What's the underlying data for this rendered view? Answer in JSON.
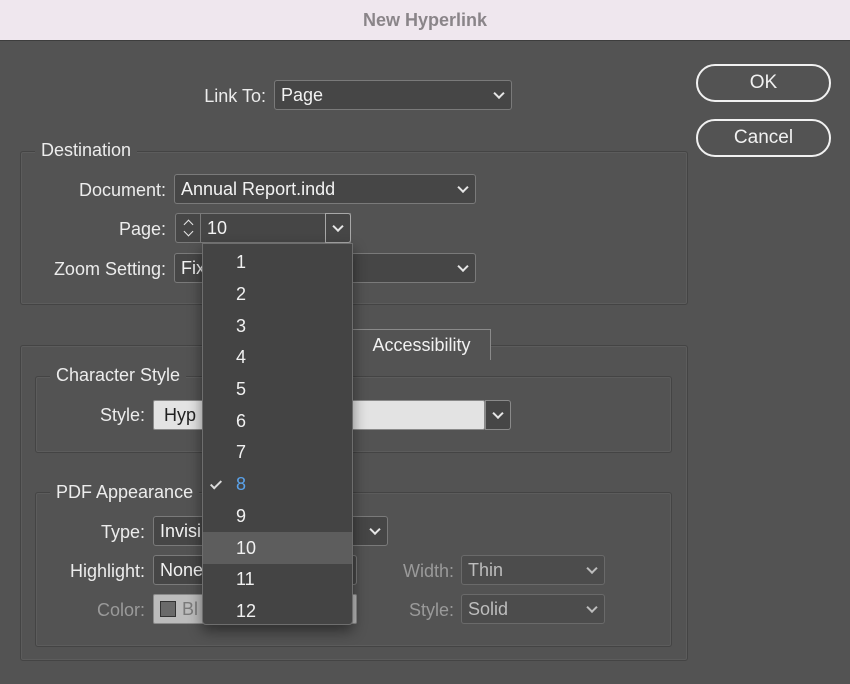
{
  "window": {
    "title": "New Hyperlink"
  },
  "link_to": {
    "label": "Link To:",
    "value": "Page"
  },
  "buttons": {
    "ok": "OK",
    "cancel": "Cancel"
  },
  "destination": {
    "title": "Destination",
    "document_label": "Document:",
    "document_value": "Annual Report.indd",
    "page_label": "Page:",
    "page_value": "10",
    "zoom_label": "Zoom Setting:",
    "zoom_value": "Fix"
  },
  "tabs": {
    "accessibility": "Accessibility"
  },
  "character_style": {
    "title": "Character Style",
    "style_label": "Style:",
    "style_value": "Hyp"
  },
  "pdf_appearance": {
    "title": "PDF Appearance",
    "type_label": "Type:",
    "type_value": "Invisi",
    "highlight_label": "Highlight:",
    "highlight_value": "None",
    "color_label": "Color:",
    "color_value": "Bl",
    "width_label": "Width:",
    "width_value": "Thin",
    "style_label": "Style:",
    "style_value": "Solid"
  },
  "page_menu": {
    "items": [
      "1",
      "2",
      "3",
      "4",
      "5",
      "6",
      "7",
      "8",
      "9",
      "10",
      "11",
      "12"
    ],
    "checked": "8",
    "highlighted": "10"
  },
  "colors": {
    "background": "#535353",
    "title_bar": "#efe7ee",
    "selected_item": "#5aa2ea"
  }
}
